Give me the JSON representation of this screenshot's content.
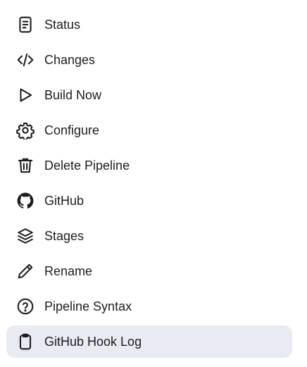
{
  "menu": {
    "items": [
      {
        "label": "Status",
        "icon": "document-icon"
      },
      {
        "label": "Changes",
        "icon": "code-icon"
      },
      {
        "label": "Build Now",
        "icon": "play-icon"
      },
      {
        "label": "Configure",
        "icon": "gear-icon"
      },
      {
        "label": "Delete Pipeline",
        "icon": "trash-icon"
      },
      {
        "label": "GitHub",
        "icon": "github-icon"
      },
      {
        "label": "Stages",
        "icon": "layers-icon"
      },
      {
        "label": "Rename",
        "icon": "pencil-icon"
      },
      {
        "label": "Pipeline Syntax",
        "icon": "help-icon"
      },
      {
        "label": "GitHub Hook Log",
        "icon": "clipboard-icon",
        "active": true
      }
    ]
  },
  "colors": {
    "text": "#1d1d1f",
    "active_background": "#e8ebf2"
  }
}
